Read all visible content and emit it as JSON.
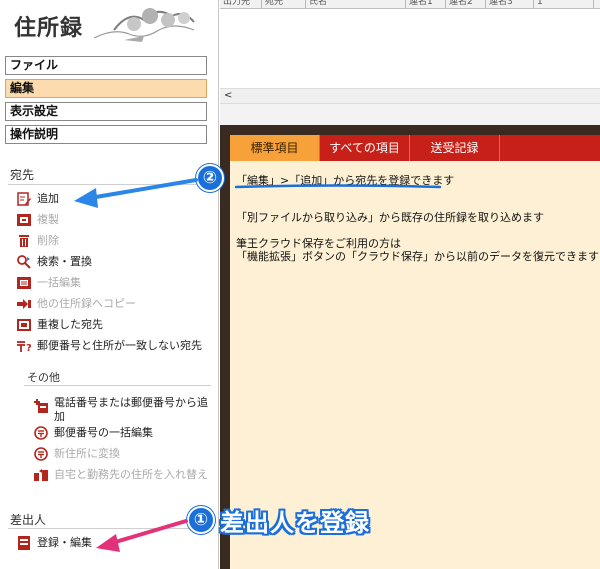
{
  "app": {
    "title": "住所録"
  },
  "menu": [
    {
      "label": "ファイル",
      "active": false
    },
    {
      "label": "編集",
      "active": true
    },
    {
      "label": "表示設定",
      "active": false
    },
    {
      "label": "操作説明",
      "active": false
    }
  ],
  "sidebar": {
    "section_recipient": "宛先",
    "recipient_items": [
      {
        "label": "追加",
        "icon": "add-edit-icon",
        "enabled": true
      },
      {
        "label": "複製",
        "icon": "duplicate-icon",
        "enabled": false
      },
      {
        "label": "削除",
        "icon": "trash-icon",
        "enabled": false
      },
      {
        "label": "検索・置換",
        "icon": "search-replace-icon",
        "enabled": true
      },
      {
        "label": "一括編集",
        "icon": "bulk-edit-icon",
        "enabled": false
      },
      {
        "label": "他の住所録へコピー",
        "icon": "copy-arrow-icon",
        "enabled": false
      },
      {
        "label": "重複した宛先",
        "icon": "duplicate-recipient-icon",
        "enabled": true
      },
      {
        "label": "郵便番号と住所が一致しない宛先",
        "icon": "postal-mismatch-icon",
        "enabled": true
      }
    ],
    "section_other": "その他",
    "other_items": [
      {
        "label": "電話番号または郵便番号から追加",
        "icon": "phone-add-icon",
        "enabled": true
      },
      {
        "label": "郵便番号の一括編集",
        "icon": "postal-mark-icon",
        "enabled": true
      },
      {
        "label": "新住所に変換",
        "icon": "postal-convert-icon",
        "enabled": false
      },
      {
        "label": "自宅と勤務先の住所を入れ替え",
        "icon": "swap-address-icon",
        "enabled": false
      }
    ],
    "section_sender": "差出人",
    "sender_items": [
      {
        "label": "登録・編集",
        "icon": "sender-register-icon",
        "enabled": true
      }
    ]
  },
  "grid": {
    "columns": [
      "出力先",
      "宛先",
      "氏名",
      "連名1",
      "連名2",
      "連名3",
      "1"
    ]
  },
  "scrollbar": {
    "left_arrow": "<"
  },
  "tabs": [
    {
      "label": "標準項目",
      "active": true
    },
    {
      "label": "すべての項目",
      "active": false
    },
    {
      "label": "送受記録",
      "active": false
    }
  ],
  "info": {
    "line1": "「編集」>「追加」から宛先を登録できます",
    "line2": "「別ファイルから取り込み」から既存の住所録を取り込めます",
    "line3": "筆王クラウド保存をご利用の方は",
    "line4": "「機能拡張」ボタンの「クラウド保存」から以前のデータを復元できます"
  },
  "annotations": {
    "num1": "①",
    "text1": "差出人を登録",
    "num2": "②"
  },
  "colors": {
    "accent_red": "#c62019",
    "tab_active": "#f7a13a",
    "annotation_blue": "#1b6fd8",
    "arrow_pink": "#e3317a"
  }
}
